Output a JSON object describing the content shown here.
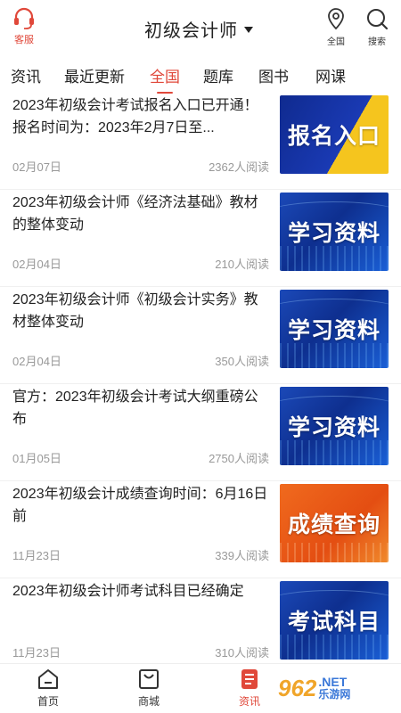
{
  "header": {
    "customer_service_label": "客服",
    "title": "初级会计师",
    "location_label": "全国",
    "search_label": "搜索"
  },
  "tabs": [
    {
      "label": "资讯",
      "active": false
    },
    {
      "label": "最近更新",
      "active": false
    },
    {
      "label": "全国",
      "active": true
    },
    {
      "label": "题库",
      "active": false
    },
    {
      "label": "图书",
      "active": false
    },
    {
      "label": "网课",
      "active": false
    }
  ],
  "articles": [
    {
      "title": "2023年初级会计考试报名入口已开通！报名时间为：2023年2月7日至...",
      "date": "02月07日",
      "reads": "2362人阅读",
      "thumb_text": "报名入口"
    },
    {
      "title": "2023年初级会计师《经济法基础》教材的整体变动",
      "date": "02月04日",
      "reads": "210人阅读",
      "thumb_text": "学习资料"
    },
    {
      "title": "2023年初级会计师《初级会计实务》教材整体变动",
      "date": "02月04日",
      "reads": "350人阅读",
      "thumb_text": "学习资料"
    },
    {
      "title": "官方：2023年初级会计考试大纲重磅公布",
      "date": "01月05日",
      "reads": "2750人阅读",
      "thumb_text": "学习资料"
    },
    {
      "title": "2023年初级会计成绩查询时间：6月16日前",
      "date": "11月23日",
      "reads": "339人阅读",
      "thumb_text": "成绩查询"
    },
    {
      "title": "2023年初级会计师考试科目已经确定",
      "date": "11月23日",
      "reads": "310人阅读",
      "thumb_text": "考试科目"
    }
  ],
  "bottom_nav": [
    {
      "label": "首页",
      "active": false
    },
    {
      "label": "商城",
      "active": false
    },
    {
      "label": "资讯",
      "active": true
    }
  ],
  "watermark": {
    "number": "962",
    "suffix": ".NET",
    "name": "乐游网"
  },
  "colors": {
    "accent": "#e0483a",
    "muted_text": "#999999"
  }
}
